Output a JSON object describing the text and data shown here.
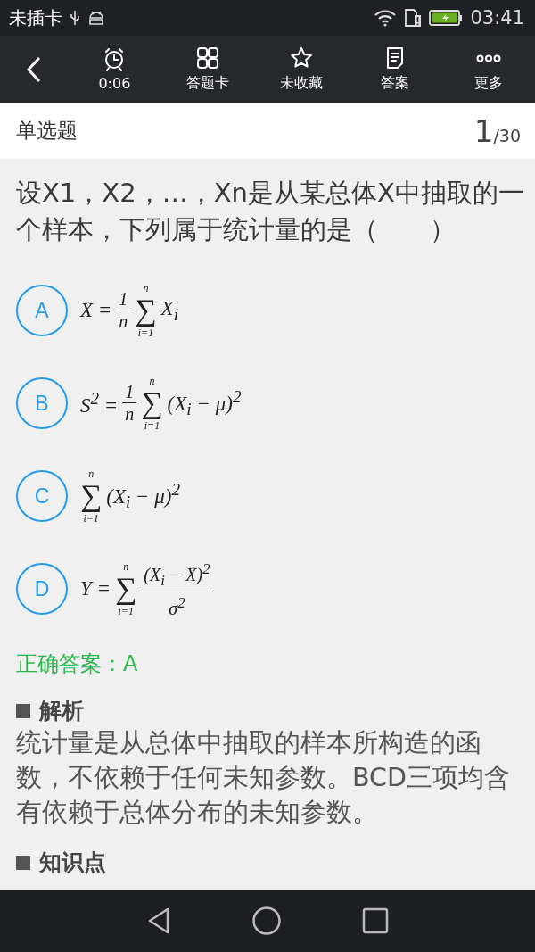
{
  "status_bar": {
    "carrier": "未插卡",
    "time": "03:41"
  },
  "toolbar": {
    "items": [
      {
        "kind": "timer",
        "label": "0:06"
      },
      {
        "kind": "card",
        "label": "答题卡"
      },
      {
        "kind": "favorite",
        "label": "未收藏"
      },
      {
        "kind": "answer",
        "label": "答案"
      },
      {
        "kind": "more",
        "label": "更多"
      }
    ]
  },
  "header": {
    "type": "单选题",
    "current": "1",
    "total": "/30"
  },
  "question": "设X1，X2，…，Xn是从某总体X中抽取的一个样本，下列属于统计量的是（　　）",
  "options": [
    {
      "letter": "A",
      "selected": false,
      "formula": [
        {
          "kind": "text",
          "text": "X̄ ="
        },
        {
          "kind": "frac",
          "num": "1",
          "den": "n"
        },
        {
          "kind": "sum",
          "symbol": "∑",
          "upper": "n",
          "lower": "i=1"
        },
        {
          "kind": "text",
          "text": "X$_{i}$"
        }
      ]
    },
    {
      "letter": "B",
      "selected": false,
      "formula": [
        {
          "kind": "text",
          "text": "S$^{2}$ ="
        },
        {
          "kind": "frac",
          "num": "1",
          "den": "n"
        },
        {
          "kind": "sum",
          "symbol": "∑",
          "upper": "n",
          "lower": "i=1"
        },
        {
          "kind": "text",
          "text": "(X$_{i}$ − μ)$^{2}$"
        }
      ]
    },
    {
      "letter": "C",
      "selected": false,
      "formula": [
        {
          "kind": "sum",
          "symbol": "∑",
          "upper": "n",
          "lower": "i=1"
        },
        {
          "kind": "text",
          "text": "(X$_{i}$ − μ)$^{2}$"
        }
      ]
    },
    {
      "letter": "D",
      "selected": false,
      "formula": [
        {
          "kind": "text",
          "text": "Y ="
        },
        {
          "kind": "sum",
          "symbol": "∑",
          "upper": "n",
          "lower": "i=1"
        },
        {
          "kind": "frac",
          "num": "(X$_{i}$ − X̄)$^{2}$",
          "den": "σ$^{2}$"
        }
      ]
    }
  ],
  "correct_answer": "正确答案：A",
  "analysis": {
    "title": "解析",
    "text": "统计量是从总体中抽取的样本所构造的函数，不依赖于任何未知参数。BCD三项均含有依赖于总体分布的未知参数。"
  },
  "next_section": {
    "title": "知识点"
  }
}
